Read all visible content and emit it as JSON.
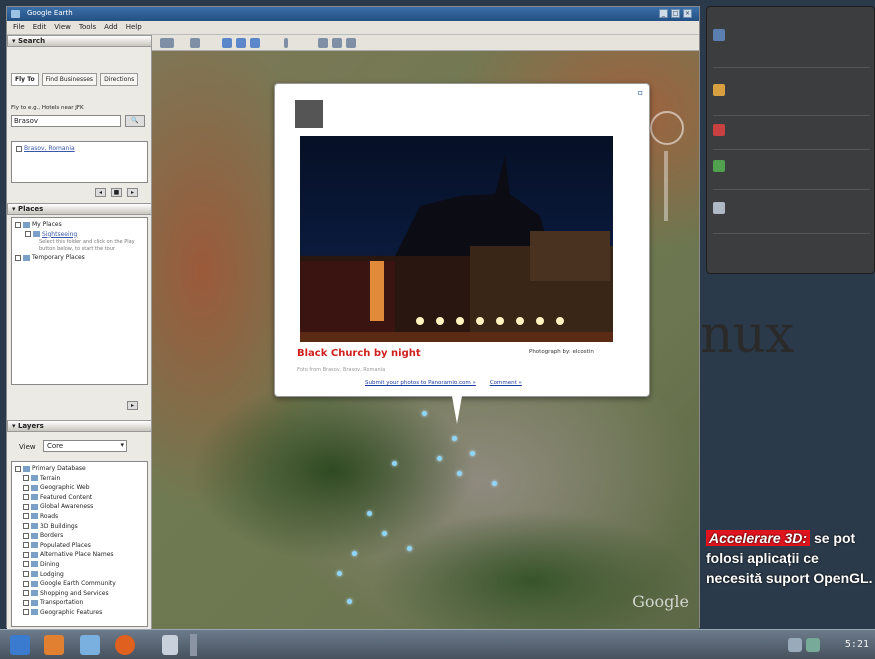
{
  "window": {
    "title": "Google Earth"
  },
  "menu": [
    "File",
    "Edit",
    "View",
    "Tools",
    "Add",
    "Help"
  ],
  "search": {
    "header": "Search",
    "tabs": [
      "Fly To",
      "Find Businesses",
      "Directions"
    ],
    "fly_to_label": "Fly to e.g., Hotels near JFK",
    "fly_to_value": "Brasov",
    "result": "Brasov, Romania"
  },
  "places": {
    "header": "Places",
    "items": [
      "My Places",
      "Sightseeing",
      "Temporary Places"
    ],
    "hint": "Select this folder and click on the Play button below, to start the tour"
  },
  "layers": {
    "header": "Layers",
    "view_label": "View",
    "view_value": "Core",
    "items": [
      "Primary Database",
      "Terrain",
      "Geographic Web",
      "Featured Content",
      "Global Awareness",
      "Roads",
      "3D Buildings",
      "Borders",
      "Populated Places",
      "Alternative Place Names",
      "Dining",
      "Lodging",
      "Google Earth Community",
      "Shopping and Services",
      "Transportation",
      "Geographic Features"
    ]
  },
  "balloon": {
    "title": "Black Church by night",
    "photographer": "Photograph by: elcostin",
    "subtitle": "Foto from Brasov, Brasov, Romania",
    "link_upload": "Submit your photos to Panoramio.com »",
    "link_comment": "Comment »"
  },
  "map": {
    "logo": "Google"
  },
  "desktop": {
    "wordmark": "nux",
    "caption_tag": "Accelerare 3D:",
    "caption_text": "se pot folosi aplicații ce necesită suport OpenGL."
  },
  "taskbar": {
    "clock": "5:21"
  },
  "colors": {
    "accent_red": "#e0141e",
    "balloon_title": "#d02020",
    "window_title": "#235083"
  }
}
